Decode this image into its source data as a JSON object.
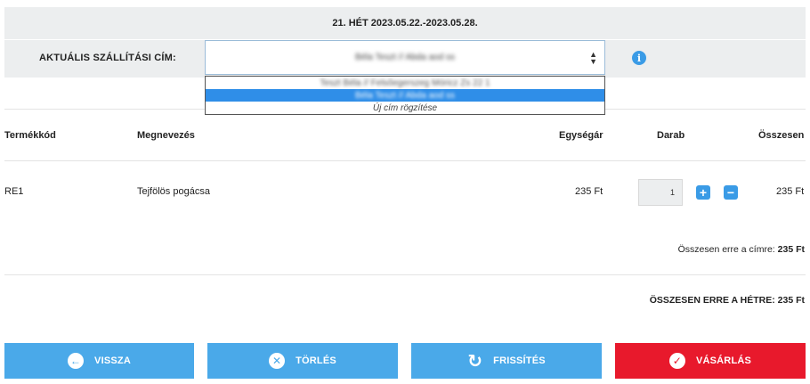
{
  "header": {
    "week_text": "21. HÉT 2023.05.22.-2023.05.28."
  },
  "address": {
    "label": "AKTUÁLIS SZÁLLÍTÁSI CÍM:",
    "selected_value": "Béla Teszt // Abda aod ss",
    "options": [
      "Teszt Béla // Felsőegerszeg Móricz Zs 22 1",
      "Béla Teszt // Abda aod ss",
      "Új cím rögzítése"
    ],
    "selected_index": 1,
    "info_icon": "info-icon"
  },
  "table": {
    "headers": {
      "code": "Termékkód",
      "name": "Megnevezés",
      "unit_price": "Egységár",
      "qty": "Darab",
      "total": "Összesen"
    },
    "rows": [
      {
        "code": "RE1",
        "name": "Tejfölös pogácsa",
        "unit_price": "235 Ft",
        "qty": "1",
        "total": "235 Ft"
      }
    ]
  },
  "summary": {
    "address_total_label": "Összesen erre a címre:",
    "address_total_value": "235 Ft",
    "week_total_label": "ÖSSZESEN ERRE A HÉTRE:",
    "week_total_value": "235 Ft"
  },
  "buttons": {
    "back": "VISSZA",
    "delete": "TÖRLÉS",
    "refresh": "FRISSÍTÉS",
    "buy": "VÁSÁRLÁS"
  },
  "colors": {
    "accent_blue": "#4aa9e9",
    "buy_red": "#e8192c",
    "bar_gray": "#eceeef"
  }
}
